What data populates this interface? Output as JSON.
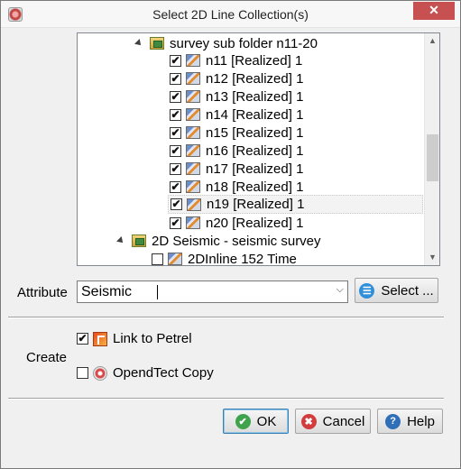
{
  "window": {
    "title": "Select 2D Line Collection(s)",
    "close_glyph": "✕"
  },
  "tree": {
    "folder_label": "survey sub folder n11-20",
    "lines": [
      {
        "label": "n11 [Realized] 1",
        "checked": true
      },
      {
        "label": "n12 [Realized] 1",
        "checked": true
      },
      {
        "label": "n13 [Realized] 1",
        "checked": true
      },
      {
        "label": "n14 [Realized] 1",
        "checked": true
      },
      {
        "label": "n15 [Realized] 1",
        "checked": true
      },
      {
        "label": "n16 [Realized] 1",
        "checked": true
      },
      {
        "label": "n17 [Realized] 1",
        "checked": true
      },
      {
        "label": "n18 [Realized] 1",
        "checked": true
      },
      {
        "label": "n19 [Realized] 1",
        "checked": true
      },
      {
        "label": "n20 [Realized] 1",
        "checked": true
      }
    ],
    "survey_label": "2D Seismic - seismic survey",
    "survey_child": {
      "label": "2DInline 152 Time",
      "checked": false
    }
  },
  "attribute": {
    "label": "Attribute",
    "value": "Seismic",
    "select_button": "Select ..."
  },
  "create": {
    "label": "Create",
    "link_to_petrel": {
      "label": "Link to Petrel",
      "checked": true
    },
    "opendtect_copy": {
      "label": "OpendTect Copy",
      "checked": false
    }
  },
  "buttons": {
    "ok": "OK",
    "cancel": "Cancel",
    "help": "Help"
  },
  "glyphs": {
    "check": "✔",
    "ok_icon": "✔",
    "cancel_icon": "✖",
    "help_icon": "?",
    "select_icon": "☰",
    "scroll_up": "▲",
    "scroll_down": "▼",
    "combo_arrow": "⌵"
  },
  "colors": {
    "close_bg": "#c75050",
    "ok_icon": "#3fa34d",
    "cancel_icon": "#d23c3c",
    "help_icon": "#2f6fb8",
    "select_icon": "#2f8fd8"
  }
}
